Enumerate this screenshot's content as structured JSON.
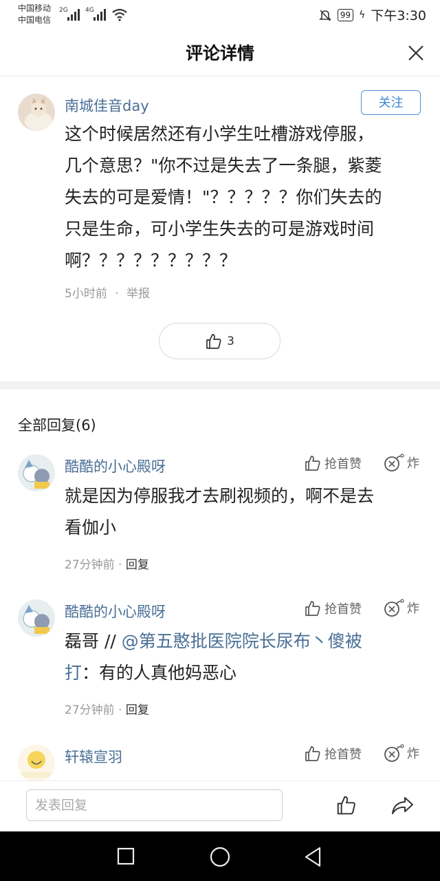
{
  "status_bar": {
    "carrier1": "中国移动",
    "carrier2": "中国电信",
    "net1": "2G",
    "net2": "4G",
    "battery": "99",
    "time": "下午3:30"
  },
  "header": {
    "title": "评论详情"
  },
  "main_comment": {
    "username": "南城佳音day",
    "follow_label": "关注",
    "text": "这个时候居然还有小学生吐槽游戏停服，几个意思？\"你不过是失去了一条腿，紫菱失去的可是爱情！\"？？？？？你们失去的只是生命，可小学生失去的可是游戏时间啊？？？？？？？？？",
    "lines": [
      "这个时候居然还有小学生吐槽游戏停服，",
      "几个意思？\"你不过是失去了一条腿，紫菱",
      "失去的可是爱情！\"？？？？？你们失去的",
      "只是生命，可小学生失去的可是游戏时间",
      "啊？？？？？？？？？"
    ],
    "time": "5小时前",
    "dot": "·",
    "report": "举报",
    "likes": "3"
  },
  "replies_title": "全部回复(6)",
  "replies": [
    {
      "username": "酷酷的小心殿呀",
      "like_label": "抢首赞",
      "bomb_label": "炸",
      "lines": [
        "就是因为停服我才去刷视频的，啊不是去",
        "看伽小"
      ],
      "time": "27分钟前",
      "dot": "·",
      "reply_label": "回复"
    },
    {
      "username": "酷酷的小心殿呀",
      "like_label": "抢首赞",
      "bomb_label": "炸",
      "prefix": "磊哥 // ",
      "mention_line1": "@第五憨批医院院长尿布丶傻被",
      "mention_line2": "打",
      "suffix": "：有的人真他妈恶心",
      "time": "27分钟前",
      "dot": "·",
      "reply_label": "回复"
    },
    {
      "username": "轩辕宣羽",
      "like_label": "抢首赞",
      "bomb_label": "炸"
    }
  ],
  "bottom_bar": {
    "placeholder": "发表回复"
  },
  "colors": {
    "link": "#4a6f96",
    "accent": "#3a86d6",
    "separator": "#f2f2f2"
  },
  "icons": [
    "close-icon",
    "thumb-up-icon",
    "bomb-icon",
    "share-icon",
    "nav-square-icon",
    "nav-circle-icon",
    "nav-back-icon"
  ]
}
